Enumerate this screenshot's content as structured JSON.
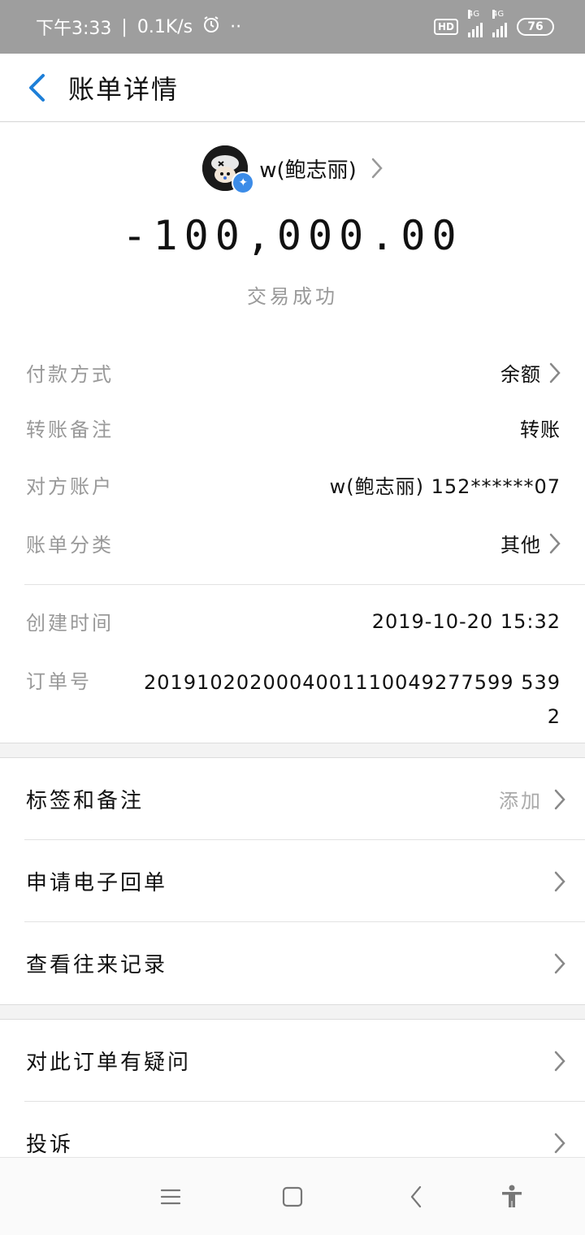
{
  "status_bar": {
    "time": "下午3:33",
    "speed": "0.1K/s",
    "hd": "HD",
    "network": "4G",
    "battery": "76"
  },
  "header": {
    "title": "账单详情"
  },
  "summary": {
    "payee_name": "w(鲍志丽)",
    "amount": "-100,000.00",
    "status": "交易成功"
  },
  "details": {
    "payment_method": {
      "label": "付款方式",
      "value": "余额"
    },
    "transfer_note": {
      "label": "转账备注",
      "value": "转账"
    },
    "counterparty_account": {
      "label": "对方账户",
      "value": "w(鲍志丽) 152******07"
    },
    "bill_category": {
      "label": "账单分类",
      "value": "其他"
    },
    "created_time": {
      "label": "创建时间",
      "value": "2019-10-20 15:32"
    },
    "order_number": {
      "label": "订单号",
      "value": "2019102020004001110049277599 5392"
    }
  },
  "actions_group1": {
    "tags_notes": {
      "label": "标签和备注",
      "action": "添加"
    },
    "e_receipt": {
      "label": "申请电子回单"
    },
    "history": {
      "label": "查看往来记录"
    }
  },
  "actions_group2": {
    "question": {
      "label": "对此订单有疑问"
    },
    "complaint": {
      "label": "投诉"
    }
  },
  "colors": {
    "accent": "#1e7fd8",
    "status_bar": "#9e9e9e",
    "muted_text": "#999999"
  },
  "icons": {
    "back": "chevron-left-icon",
    "chevron": "chevron-right-icon",
    "verified": "verified-badge-icon",
    "alarm": "alarm-icon",
    "menu": "menu-icon",
    "home": "home-icon",
    "nav_back": "back-icon",
    "accessibility": "accessibility-icon"
  }
}
